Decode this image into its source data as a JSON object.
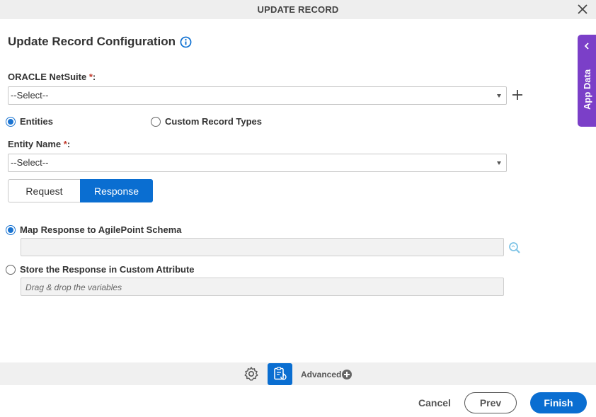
{
  "dialog": {
    "title": "UPDATE RECORD"
  },
  "config": {
    "heading": "Update Record Configuration",
    "oracle_label": "ORACLE NetSuite",
    "oracle_required": "*",
    "oracle_colon": ":",
    "oracle_select_value": "--Select--",
    "radio_entities": "Entities",
    "radio_custom_record": "Custom Record Types",
    "entity_label": "Entity Name",
    "entity_required": "*",
    "entity_colon": ":",
    "entity_select_value": "--Select--",
    "selected_record_type": "Entities"
  },
  "tabs": [
    {
      "label": "Request",
      "active": false
    },
    {
      "label": "Response",
      "active": true
    }
  ],
  "response": {
    "map_option": "Map Response to AgilePoint Schema",
    "map_selected": true,
    "map_value": "",
    "store_option": "Store the Response in Custom Attribute",
    "store_selected": false,
    "store_placeholder": "Drag & drop the variables"
  },
  "side_panel": {
    "label": "App Data"
  },
  "footer": {
    "advanced_label": "Advanced",
    "cancel_label": "Cancel",
    "prev_label": "Prev",
    "finish_label": "Finish"
  },
  "colors": {
    "primary": "#0a6ed1",
    "side_panel": "#7b3fc8",
    "required": "#c0392b"
  },
  "icons": [
    "close-icon",
    "info-icon",
    "plus-icon",
    "search-icon",
    "chevron-left-icon",
    "gear-icon",
    "mapping-icon",
    "add-circle-icon"
  ]
}
